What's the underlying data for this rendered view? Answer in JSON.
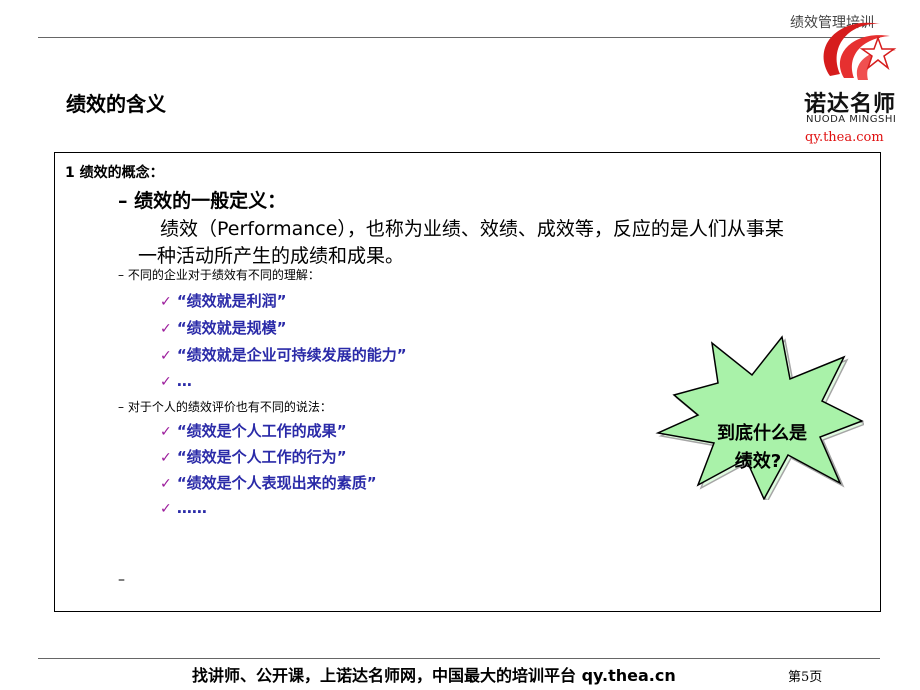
{
  "header": {
    "title": "绩效管理培训"
  },
  "logo": {
    "cn": "诺达名师",
    "en": "NUODA MINGSHI",
    "url": "qy.thea.com"
  },
  "page_title": "绩效的含义",
  "content": {
    "section": "1 绩效的概念：",
    "def_heading": "– 绩效的一般定义：",
    "def_line1": "绩效（Performance），也称为业绩、效绩、成效等，反应的是人们从事某",
    "def_line2": "一种活动所产生的成绩和成果。",
    "org_heading": "– 不同的企业对于绩效有不同的理解：",
    "org_items": [
      "“绩效就是利润”",
      "“绩效就是规模”",
      "“绩效就是企业可持续发展的能力”",
      "…"
    ],
    "ind_heading": "– 对于个人的绩效评价也有不同的说法：",
    "ind_items": [
      "“绩效是个人工作的成果”",
      "“绩效是个人工作的行为”",
      "“绩效是个人表现出来的素质”",
      "……"
    ],
    "last_dash": "–",
    "check_mark": "✓"
  },
  "callout": {
    "line1": "到底什么是",
    "line2": "绩效?"
  },
  "footer": {
    "text": "找讲师、公开课，上诺达名师网，中国最大的培训平台  qy.thea.cn",
    "page": "第5页"
  },
  "colors": {
    "check": "#9b1b9b",
    "quote": "#2a2aa8",
    "star_fill": "#a9f2a9",
    "logo_red": "#e01010"
  }
}
